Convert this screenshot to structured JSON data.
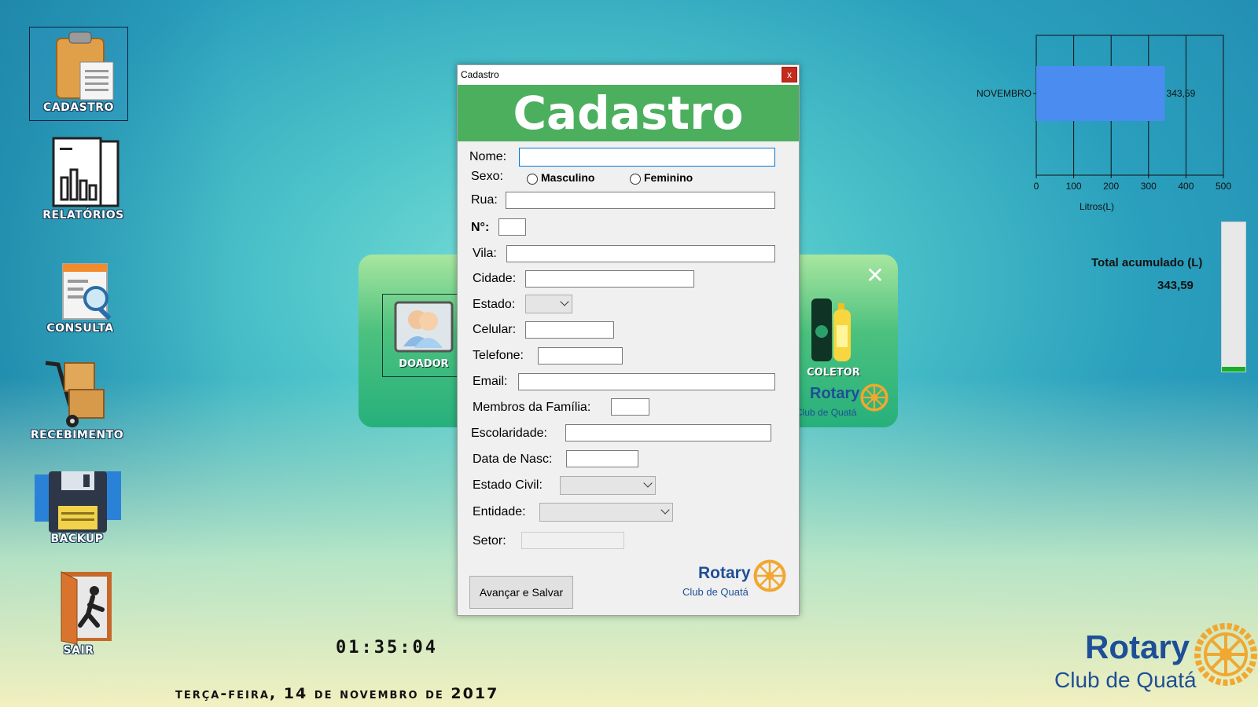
{
  "desktop": {
    "icons": [
      {
        "label": "CADASTRO",
        "icon": "clipboard-icon"
      },
      {
        "label": "RELATÓRIOS",
        "icon": "report-chart-icon"
      },
      {
        "label": "CONSULTA",
        "icon": "search-document-icon"
      },
      {
        "label": "RECEBIMENTO",
        "icon": "hand-truck-icon"
      },
      {
        "label": "BACKUP",
        "icon": "floppy-disk-icon"
      },
      {
        "label": "SAIR",
        "icon": "exit-door-icon"
      }
    ]
  },
  "chart_data": {
    "type": "bar",
    "orientation": "horizontal",
    "categories": [
      "NOVEMBRO"
    ],
    "values": [
      343.59
    ],
    "data_labels": [
      "343,59"
    ],
    "xlabel": "Litros(L)",
    "xticks": [
      "0",
      "100",
      "200",
      "300",
      "400",
      "500"
    ],
    "xlim": [
      0,
      500
    ],
    "grid": true,
    "bar_color": "#4a8cf0"
  },
  "total": {
    "label": "Total acumulado (L)",
    "value": "343,59",
    "gauge_fraction": 0.03,
    "gauge_color": "#15b028"
  },
  "clock": "01:35:04",
  "date": "terça-feira, 14 de novembro de 2017",
  "brand": {
    "name": "Rotary",
    "club": "Club de Quatá",
    "color": "#1e4f96"
  },
  "panel": {
    "doador_label": "DOADOR",
    "coletor_label": "COLETOR",
    "close_glyph": "✕"
  },
  "dialog": {
    "window_title": "Cadastro",
    "close_glyph": "x",
    "banner": "Cadastro",
    "fields": {
      "nome": "Nome:",
      "sexo": "Sexo:",
      "rua": "Rua:",
      "numero": "N°:",
      "vila": "Vila:",
      "cidade": "Cidade:",
      "estado": "Estado:",
      "celular": "Celular:",
      "telefone": "Telefone:",
      "email": "Email:",
      "membros": "Membros da Família:",
      "escolaridade": "Escolaridade:",
      "nascimento": "Data de Nasc:",
      "estado_civil": "Estado Civil:",
      "entidade": "Entidade:",
      "setor": "Setor:"
    },
    "sexo_options": [
      "Masculino",
      "Feminino"
    ],
    "submit_label": "Avançar e Salvar"
  }
}
